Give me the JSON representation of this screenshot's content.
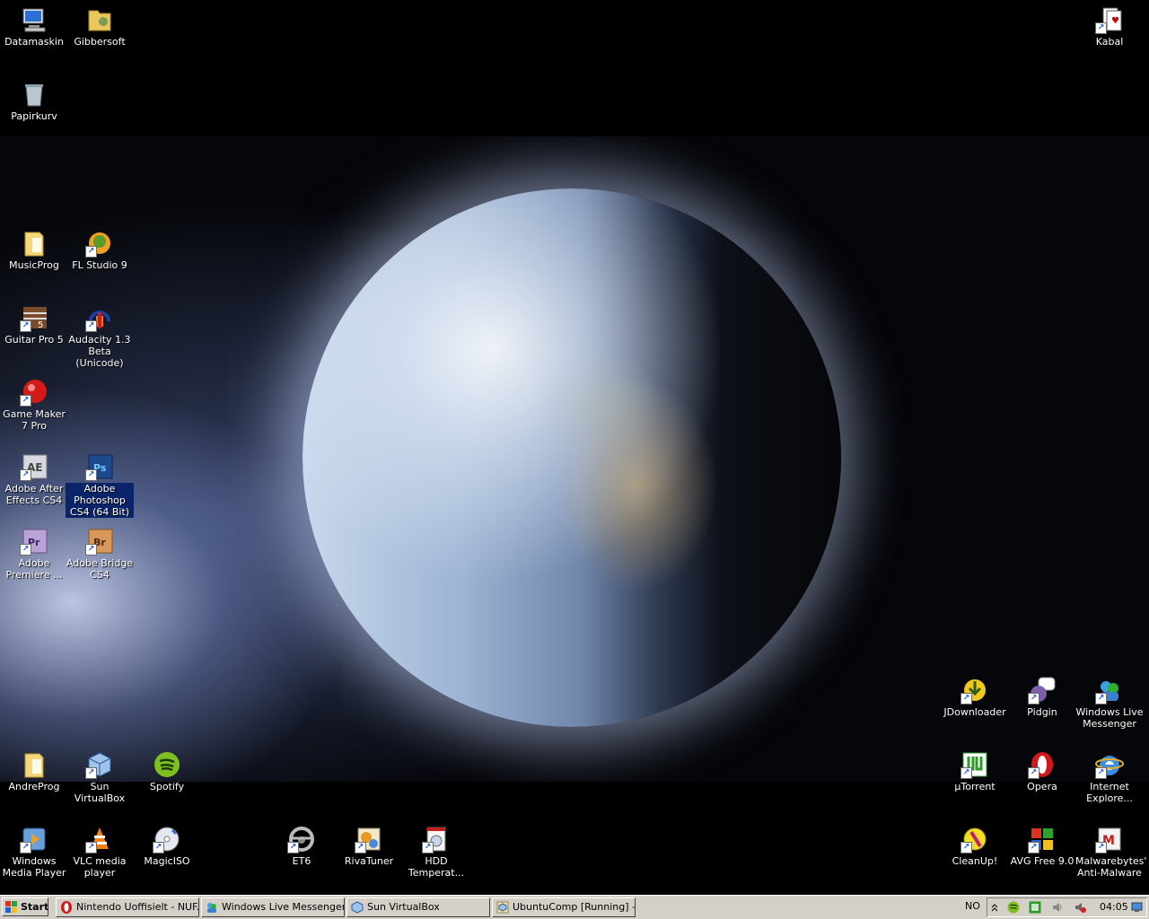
{
  "desktop": {
    "icons": [
      {
        "name": "datamaskin",
        "label": "Datamaskin",
        "icon": "computer-icon",
        "shortcut": false
      },
      {
        "name": "gibbersoft",
        "label": "Gibbersoft",
        "icon": "folder-icon",
        "shortcut": false
      },
      {
        "name": "kabal",
        "label": "Kabal",
        "icon": "cards-icon",
        "shortcut": true
      },
      {
        "name": "papirkurv",
        "label": "Papirkurv",
        "icon": "recycle-bin-icon",
        "shortcut": false
      },
      {
        "name": "musicprog",
        "label": "MusicProg",
        "icon": "folder-icon",
        "shortcut": false
      },
      {
        "name": "fl-studio",
        "label": "FL Studio 9",
        "icon": "fl-studio-icon",
        "shortcut": true
      },
      {
        "name": "guitar-pro",
        "label": "Guitar Pro 5",
        "icon": "guitar-pro-icon",
        "shortcut": true
      },
      {
        "name": "audacity",
        "label": "Audacity 1.3 Beta (Unicode)",
        "icon": "audacity-icon",
        "shortcut": true
      },
      {
        "name": "game-maker",
        "label": "Game Maker 7 Pro",
        "icon": "game-maker-icon",
        "shortcut": true
      },
      {
        "name": "after-effects",
        "label": "Adobe After Effects CS4",
        "icon": "after-effects-icon",
        "shortcut": true
      },
      {
        "name": "photoshop",
        "label": "Adobe Photoshop CS4 (64 Bit)",
        "icon": "photoshop-icon",
        "shortcut": true
      },
      {
        "name": "premiere",
        "label": "Adobe Premiere ...",
        "icon": "premiere-icon",
        "shortcut": true
      },
      {
        "name": "bridge",
        "label": "Adobe Bridge CS4",
        "icon": "bridge-icon",
        "shortcut": true
      },
      {
        "name": "jdownloader",
        "label": "JDownloader",
        "icon": "jdownloader-icon",
        "shortcut": true
      },
      {
        "name": "pidgin",
        "label": "Pidgin",
        "icon": "pidgin-icon",
        "shortcut": true
      },
      {
        "name": "wl-messenger",
        "label": "Windows Live Messenger",
        "icon": "messenger-icon",
        "shortcut": true
      },
      {
        "name": "andreprog",
        "label": "AndreProg",
        "icon": "folder-icon",
        "shortcut": false
      },
      {
        "name": "virtualbox",
        "label": "Sun VirtualBox",
        "icon": "virtualbox-icon",
        "shortcut": true
      },
      {
        "name": "spotify",
        "label": "Spotify",
        "icon": "spotify-icon",
        "shortcut": false
      },
      {
        "name": "utorrent",
        "label": "µTorrent",
        "icon": "utorrent-icon",
        "shortcut": true
      },
      {
        "name": "opera",
        "label": "Opera",
        "icon": "opera-icon",
        "shortcut": true
      },
      {
        "name": "internet-explorer",
        "label": "Internet Explore...",
        "icon": "ie-icon",
        "shortcut": true
      },
      {
        "name": "wmp",
        "label": "Windows Media Player",
        "icon": "media-player-icon",
        "shortcut": true
      },
      {
        "name": "vlc",
        "label": "VLC media player",
        "icon": "vlc-icon",
        "shortcut": true
      },
      {
        "name": "magiciso",
        "label": "MagicISO",
        "icon": "magiciso-icon",
        "shortcut": true
      },
      {
        "name": "et6",
        "label": "ET6",
        "icon": "steering-wheel-icon",
        "shortcut": true
      },
      {
        "name": "rivatuner",
        "label": "RivaTuner",
        "icon": "rivatuner-icon",
        "shortcut": true
      },
      {
        "name": "hdd-temp",
        "label": "HDD Temperat...",
        "icon": "hdd-temperature-icon",
        "shortcut": true
      },
      {
        "name": "cleanup",
        "label": "CleanUp!",
        "icon": "cleanup-icon",
        "shortcut": true
      },
      {
        "name": "avg",
        "label": "AVG Free 9.0",
        "icon": "avg-icon",
        "shortcut": true
      },
      {
        "name": "malwarebytes",
        "label": "Malwarebytes' Anti-Malware",
        "icon": "malwarebytes-icon",
        "shortcut": true
      }
    ]
  },
  "taskbar": {
    "start_label": "Start",
    "tasks": [
      {
        "label": "Nintendo Uoffisielt - NUF...",
        "icon": "opera-icon"
      },
      {
        "label": "Windows Live Messenger",
        "icon": "messenger-icon"
      },
      {
        "label": "Sun VirtualBox",
        "icon": "virtualbox-icon"
      },
      {
        "label": "UbuntuComp [Running] -...",
        "icon": "virtualbox-icon"
      }
    ],
    "language": "NO",
    "tray_icons": [
      "chevron-up-icon",
      "spotify-icon",
      "utorrent-icon",
      "network-volume-icon",
      "volume-muted-icon",
      "network-icon"
    ],
    "clock": "04:05"
  },
  "colors": {
    "taskbar": "#d4d0c8",
    "selection": "#0a246a",
    "desktop": "#000000"
  }
}
